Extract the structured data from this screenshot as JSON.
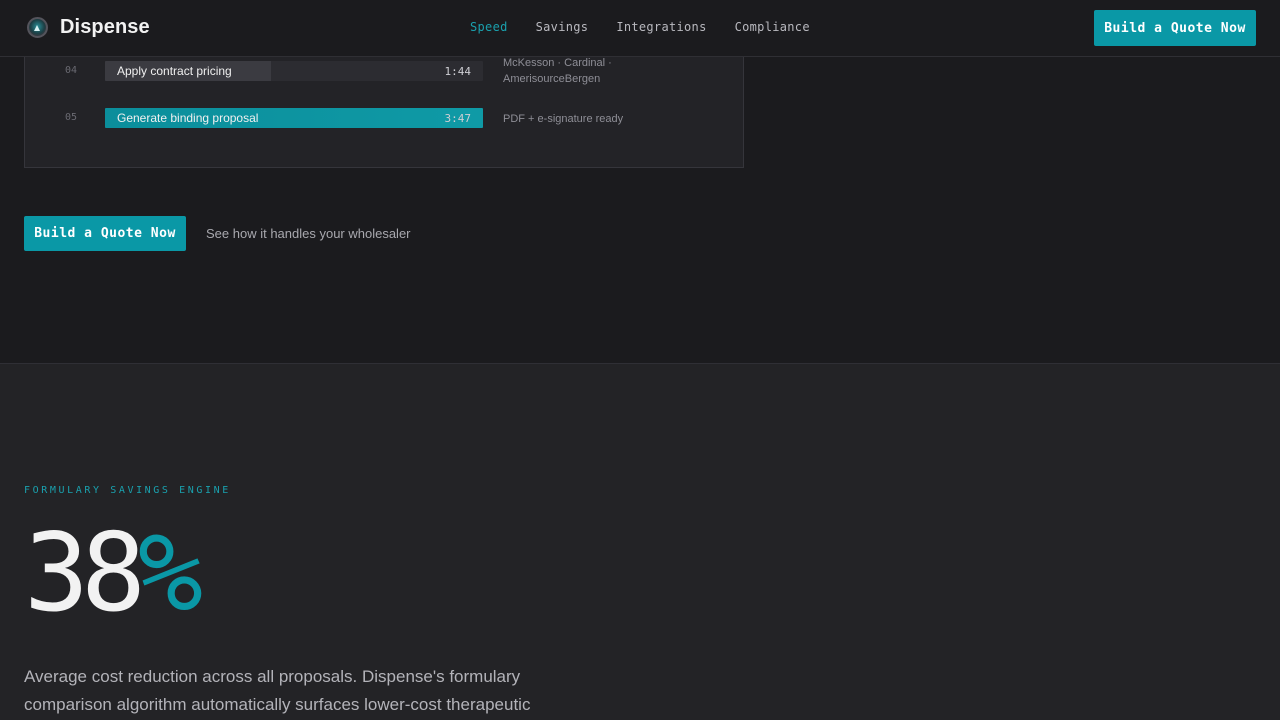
{
  "nav": {
    "brand": "Dispense",
    "links": [
      {
        "label": "Speed",
        "active": true
      },
      {
        "label": "Savings",
        "active": false
      },
      {
        "label": "Integrations",
        "active": false
      },
      {
        "label": "Compliance",
        "active": false
      }
    ],
    "cta": "Build a Quote Now"
  },
  "timeline": {
    "steps": [
      {
        "num": "04",
        "label": "Apply contract pricing",
        "time": "1:44",
        "progress_percent": 44,
        "note": "McKesson · Cardinal · AmerisourceBergen"
      },
      {
        "num": "05",
        "label": "Generate binding proposal",
        "time": "3:47",
        "progress_percent": 100,
        "note": "PDF + e-signature ready"
      }
    ]
  },
  "hero": {
    "cta": "Build a Quote Now",
    "secondary_link": "See how it handles your wholesaler"
  },
  "savings": {
    "eyebrow": "FORMULARY SAVINGS ENGINE",
    "stat_number": "38",
    "stat_unit": "%",
    "description": "Average cost reduction across all proposals. Dispense's formulary comparison algorithm automatically surfaces lower-cost therapeutic"
  },
  "colors": {
    "accent": "#0a98a6",
    "background": "#1b1b1e",
    "section_bg": "#232326"
  }
}
